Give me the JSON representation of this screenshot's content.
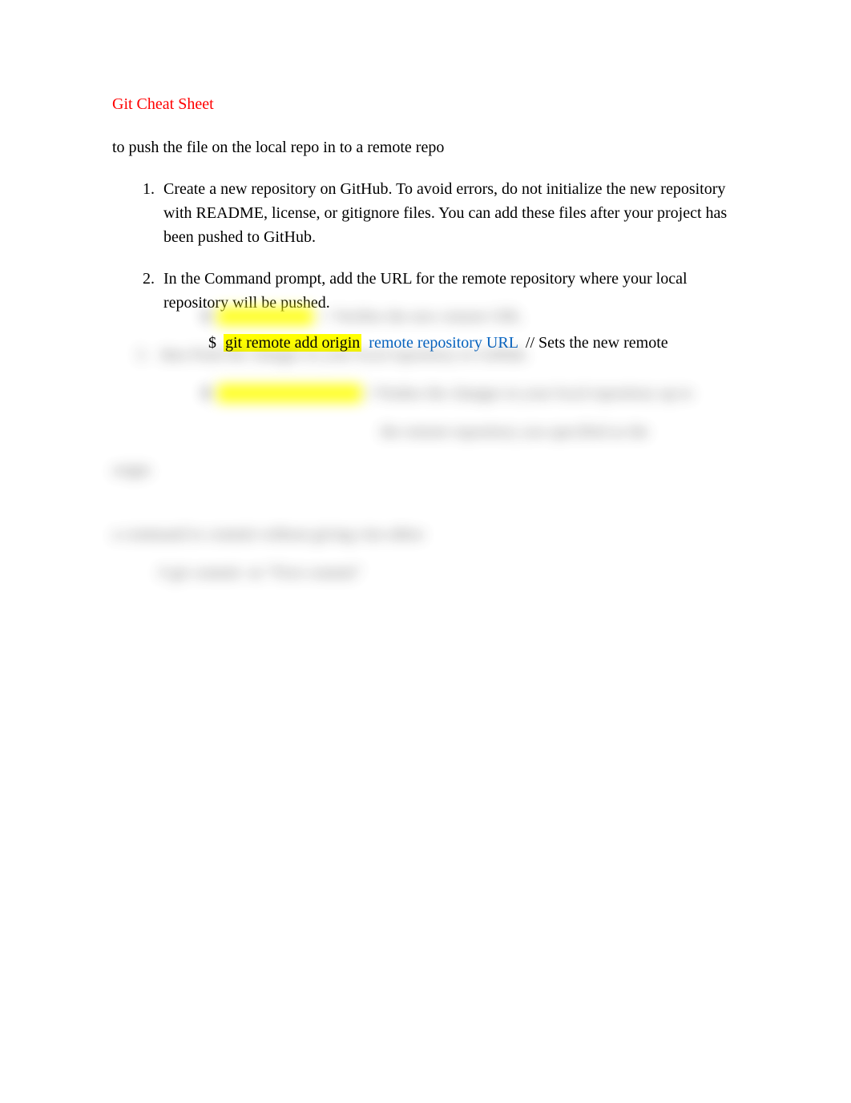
{
  "title": "Git Cheat Sheet",
  "intro": "to push the file on the local repo in to a remote repo",
  "steps": [
    {
      "text": "Create a new repository on GitHub. To avoid errors, do not initialize the new repository with README, license, or gitignore files. You can add these files after your project has been pushed to GitHub."
    },
    {
      "text": "In the Command prompt, add the URL for the remote repository where your local repository will be pushed.",
      "command": {
        "prompt": "$",
        "highlighted": "git remote add origin",
        "url": "remote repository URL",
        "comment": "// Sets the new remote"
      }
    }
  ],
  "blurred": {
    "line1": {
      "prompt": "$",
      "highlighted": "git remote -v",
      "comment": "// Verifies the new remote URL"
    },
    "step3": "then Push the changes in your local repository to GitHub.",
    "line2": {
      "prompt": "$",
      "highlighted": "git push origin master",
      "comment": "// Pushes the changes in your local repository up to"
    },
    "line3": "the remote repository you specified as the",
    "line4": "origin",
    "section2_title": "a command to commit without giving vim editor",
    "section2_cmd": "# git commit -m \"First commit\""
  }
}
